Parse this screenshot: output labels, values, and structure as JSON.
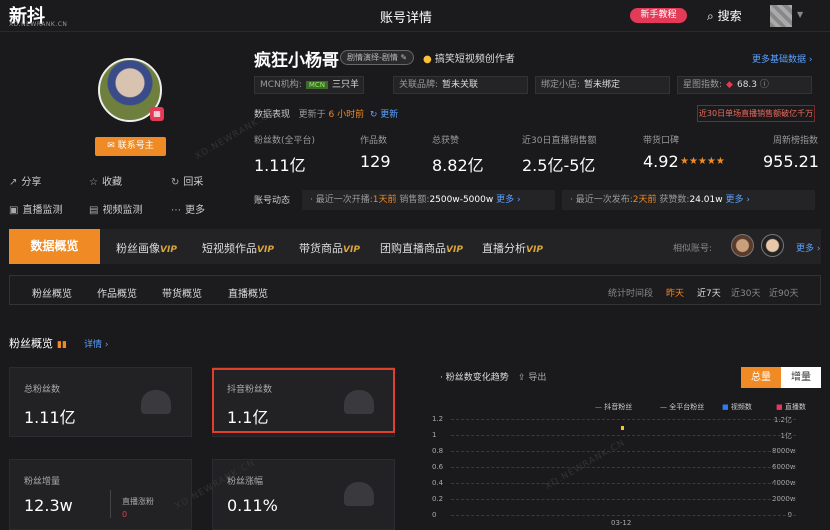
{
  "header": {
    "logo": "新抖",
    "logo_sub": "XD.NEWRANK.CN",
    "title": "账号详情",
    "tutorial": "新手教程",
    "search": "搜索"
  },
  "profile": {
    "name": "疯狂小杨哥",
    "tag": "剧情演绎-剧情",
    "creator": "搞笑短视频创作者",
    "more_info": "更多基础数据",
    "contact": "联系号主",
    "actions": [
      "分享",
      "收藏",
      "回采",
      "直播监测",
      "视频监测",
      "更多"
    ],
    "mcn_label": "MCN机构:",
    "mcn_badge": "MCN",
    "mcn_value": "三只羊",
    "brand_label": "关联品牌:",
    "brand_value": "暂未关联",
    "shop_label": "绑定小店:",
    "shop_value": "暂未绑定",
    "star_label": "星图指数:",
    "star_value": "68.3",
    "perf_label": "数据表现",
    "update_prefix": "更新于",
    "update_time": "6 小时前",
    "update_btn": "更新",
    "warning": "近30日单场直播销售额破亿千万"
  },
  "stats": [
    {
      "label": "粉丝数(全平台)",
      "value": "1.11亿"
    },
    {
      "label": "作品数",
      "value": "129"
    },
    {
      "label": "总获赞",
      "value": "8.82亿"
    },
    {
      "label": "近30日直播销售额",
      "value": "2.5亿-5亿"
    },
    {
      "label": "带货口碑",
      "value": "4.92",
      "stars": "★★★★★"
    },
    {
      "label": "周新榜指数",
      "value": "955.21"
    }
  ],
  "dynamics": {
    "label": "账号动态",
    "live_prefix": "最近一次开播:",
    "live_time": "1天前",
    "sales_label": "销售额:",
    "sales_value": "2500w-5000w",
    "more1": "更多",
    "post_prefix": "最近一次发布:",
    "post_time": "2天前",
    "likes_label": "获赞数:",
    "likes_value": "24.01w",
    "more2": "更多"
  },
  "tabs": {
    "active": "数据概览",
    "items": [
      "粉丝画像",
      "短视频作品",
      "带货商品",
      "团购直播商品",
      "直播分析"
    ],
    "vip": "VIP",
    "similar": "相似账号:",
    "more": "更多"
  },
  "subtabs": {
    "items": [
      "粉丝概览",
      "作品概览",
      "带货概览",
      "直播概览"
    ],
    "period_label": "统计时间段",
    "periods": [
      "昨天",
      "近7天",
      "近30天",
      "近90天"
    ]
  },
  "fans": {
    "section": "粉丝概览",
    "detail": "详情",
    "total_label": "总粉丝数",
    "total_value": "1.11亿",
    "douyin_label": "抖音粉丝数",
    "douyin_value": "1.1亿",
    "growth_label": "粉丝增量",
    "growth_value": "12.3w",
    "live_growth_label": "直播涨粉",
    "live_growth_value": "0",
    "rate_label": "粉丝涨幅",
    "rate_value": "0.11%"
  },
  "chart_data": {
    "type": "line",
    "title": "粉丝数变化趋势",
    "export": "导出",
    "toggle": [
      "总量",
      "增量"
    ],
    "series": [
      {
        "name": "抖音粉丝",
        "color": "#f08a24"
      },
      {
        "name": "全平台粉丝",
        "color": "#f7c23a"
      },
      {
        "name": "视频数",
        "color": "#2d7bf0"
      },
      {
        "name": "直播数",
        "color": "#e33a57"
      }
    ],
    "y_left": [
      "1.2",
      "1",
      "0.8",
      "0.6",
      "0.4",
      "0.2",
      "0"
    ],
    "y_right": [
      "1.2亿",
      "1亿",
      "8000w",
      "6000w",
      "4000w",
      "2000w",
      "0"
    ],
    "categories": [
      "03-12"
    ]
  }
}
